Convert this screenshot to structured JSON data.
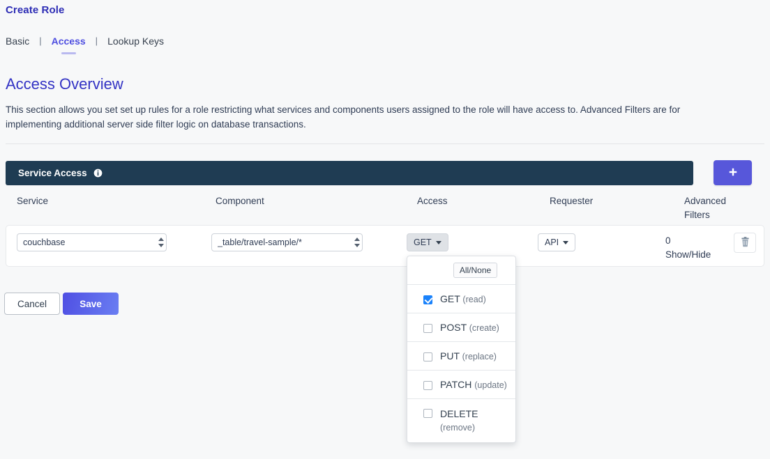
{
  "header": {
    "title": "Create Role",
    "tabs": [
      {
        "label": "Basic",
        "active": false
      },
      {
        "label": "Access",
        "active": true
      },
      {
        "label": "Lookup Keys",
        "active": false
      }
    ],
    "tab_separator": "|"
  },
  "overview": {
    "heading": "Access Overview",
    "description": "This section allows you set set up rules for a role restricting what services and components users assigned to the role will have access to. Advanced Filters are for implementing additional server side filter logic on database transactions."
  },
  "service_access": {
    "bar_label": "Service Access",
    "info_icon": "info-circle-icon",
    "add_icon": "plus-icon",
    "columns": [
      "Service",
      "Component",
      "Access",
      "Requester",
      "Advanced Filters"
    ],
    "column_advanced_line1": "Advanced",
    "column_advanced_line2": "Filters",
    "rows": [
      {
        "service": "couchbase",
        "component": "_table/travel-sample/*",
        "access": "GET",
        "requester": "API",
        "advanced_filter_count": "0",
        "advanced_filter_toggle": "Show/Hide",
        "delete_icon": "trash-icon"
      }
    ]
  },
  "access_dropdown": {
    "all_none_label": "All/None",
    "options": [
      {
        "verb": "GET",
        "note": "(read)",
        "checked": true,
        "wrap": false
      },
      {
        "verb": "POST",
        "note": "(create)",
        "checked": false,
        "wrap": false
      },
      {
        "verb": "PUT",
        "note": "(replace)",
        "checked": false,
        "wrap": false
      },
      {
        "verb": "PATCH",
        "note": "(update)",
        "checked": false,
        "wrap": false
      },
      {
        "verb": "DELETE",
        "note": "(remove)",
        "checked": false,
        "wrap": true
      }
    ]
  },
  "footer": {
    "cancel_label": "Cancel",
    "save_label": "Save"
  },
  "colors": {
    "brand_indigo": "#4e4ee0",
    "heading_blue": "#3333c4",
    "bar_navy": "#1f3c53",
    "add_button": "#5757da",
    "checkbox_checked": "#1a82fb",
    "page_background": "#f7f8f9"
  }
}
